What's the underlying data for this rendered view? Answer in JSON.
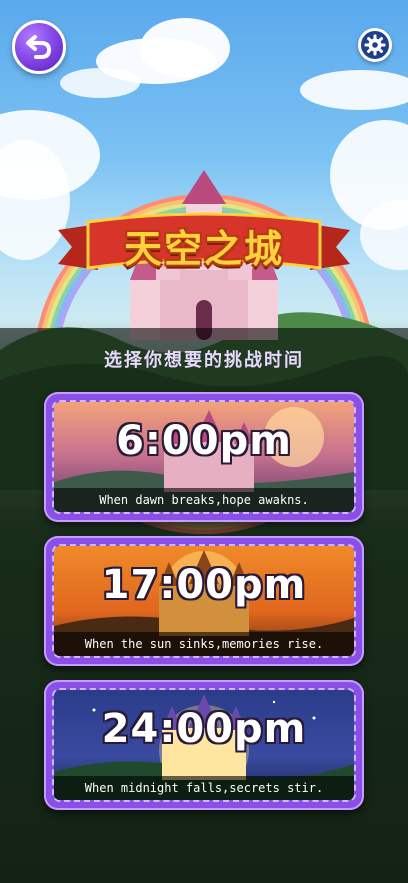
{
  "header": {
    "back_icon": "undo-arrow-icon",
    "settings_icon": "gear-icon"
  },
  "logo": {
    "title": "天空之城"
  },
  "prompt": "选择你想要的挑战时间",
  "cards": [
    {
      "time": "6:00pm",
      "caption": "When dawn breaks,hope awakns.",
      "theme": "dawn"
    },
    {
      "time": "17:00pm",
      "caption": "When the sun sinks,memories rise.",
      "theme": "sunset"
    },
    {
      "time": "24:00pm",
      "caption": "When midnight falls,secrets stir.",
      "theme": "midnight"
    }
  ],
  "colors": {
    "card_frame": "#8a4fe6",
    "back_button": "#7a3ce0",
    "settings_button": "#1f3f8c",
    "title_gold": "#ffd23d",
    "banner_red": "#d8352a"
  }
}
